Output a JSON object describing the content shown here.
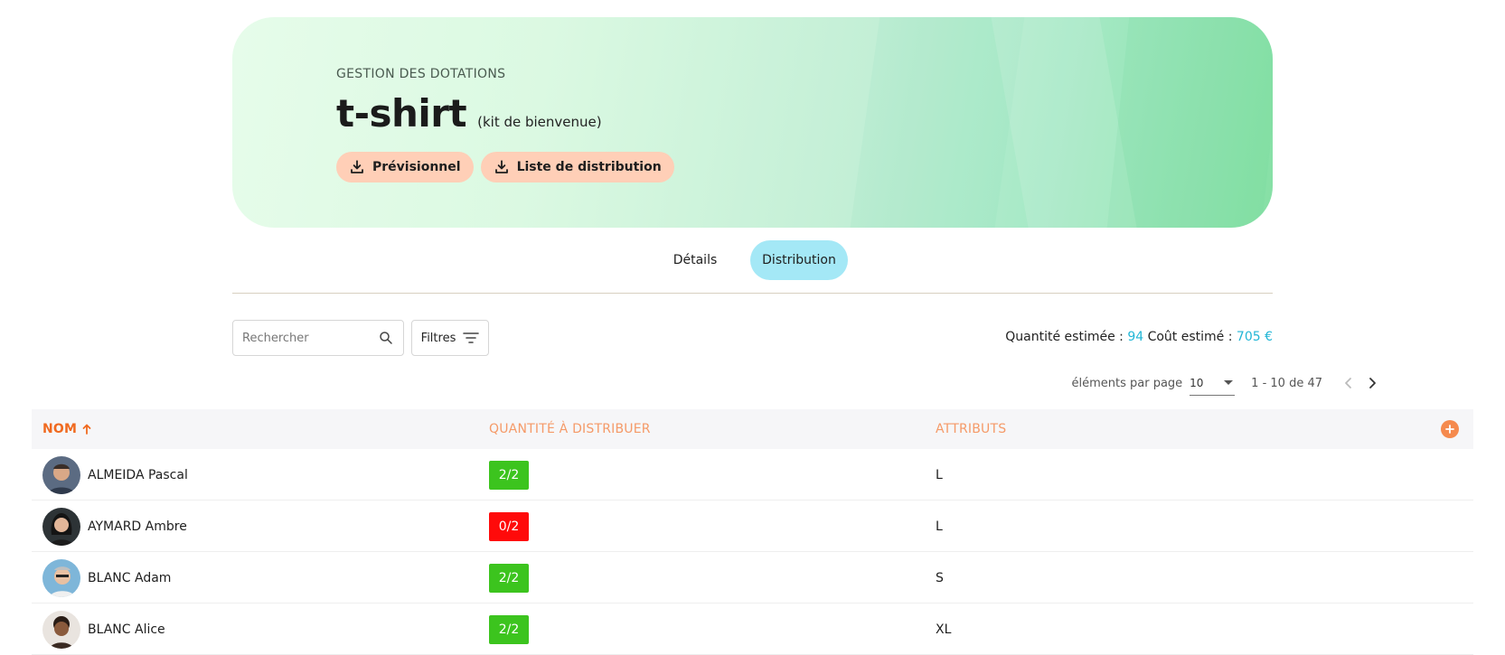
{
  "header": {
    "eyebrow": "GESTION DES DOTATIONS",
    "title": "t-shirt",
    "subtitle": "(kit de bienvenue)",
    "buttons": {
      "forecast": "Prévisionnel",
      "distribution_list": "Liste de distribution"
    }
  },
  "tabs": [
    {
      "label": "Détails",
      "active": false
    },
    {
      "label": "Distribution",
      "active": true
    }
  ],
  "toolbar": {
    "search_placeholder": "Rechercher",
    "filters_label": "Filtres",
    "estimated_quantity_label": "Quantité estimée :",
    "estimated_quantity": "94",
    "estimated_cost_label": "Coût estimé :",
    "estimated_cost": "705 €"
  },
  "pagination": {
    "per_page_label": "éléments par page",
    "per_page_value": "10",
    "range": "1 - 10 de 47"
  },
  "table": {
    "columns": [
      "NOM",
      "QUANTITÉ À DISTRIBUER",
      "ATTRIBUTS"
    ],
    "rows": [
      {
        "name": "ALMEIDA Pascal",
        "qty": "2/2",
        "status": "complete",
        "attr": "L"
      },
      {
        "name": "AYMARD Ambre",
        "qty": "0/2",
        "status": "missing",
        "attr": "L"
      },
      {
        "name": "BLANC Adam",
        "qty": "2/2",
        "status": "complete",
        "attr": "S"
      },
      {
        "name": "BLANC Alice",
        "qty": "2/2",
        "status": "complete",
        "attr": "XL"
      }
    ]
  },
  "colors": {
    "accent_orange": "#f06a20",
    "accent_cyan": "#22b6d6",
    "status_complete": "#3cc41e",
    "status_missing": "#ff0a0a",
    "tab_active": "#a4e8f6",
    "hero_button": "#ffcfb7"
  },
  "icons": {
    "download": "download-icon",
    "search": "search-icon",
    "filter": "filter-lines-icon",
    "sort": "arrow-up-icon",
    "add": "plus-circle-icon",
    "prev": "chevron-left-icon",
    "next": "chevron-right-icon"
  }
}
